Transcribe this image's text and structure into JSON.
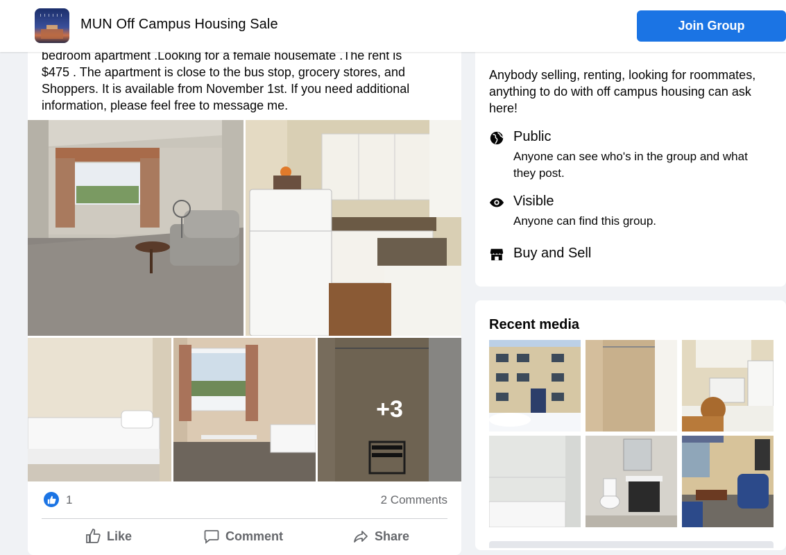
{
  "header": {
    "group_name": "MUN Off Campus Housing Sale",
    "join_label": "Join Group"
  },
  "post": {
    "text_lines": [
      "bedroom apartment .Looking for a female housemate .The rent is",
      "$475 . The apartment is close to the bus stop, grocery stores, and",
      "Shoppers. It is available from November 1st. If you need additional",
      "information, please feel free to message me."
    ],
    "more_photos_label": "+3",
    "reaction_count": "1",
    "comments_label": "2 Comments",
    "actions": {
      "like": "Like",
      "comment": "Comment",
      "share": "Share"
    }
  },
  "about": {
    "description_lines": [
      "Anybody selling, renting, looking for roommates,",
      "anything to do with off campus housing can ask",
      "here!"
    ],
    "items": [
      {
        "title": "Public",
        "icon": "globe-icon",
        "desc_lines": [
          "Anyone can see who's in the group and what",
          "they post."
        ]
      },
      {
        "title": "Visible",
        "icon": "eye-icon",
        "desc_lines": [
          "Anyone can find this group."
        ]
      },
      {
        "title": "Buy and Sell",
        "icon": "shop-icon",
        "desc_lines": []
      }
    ]
  },
  "media": {
    "title": "Recent media"
  },
  "colors": {
    "accent": "#1b74e4",
    "background": "#f0f2f5",
    "secondary_text": "#65676b"
  }
}
